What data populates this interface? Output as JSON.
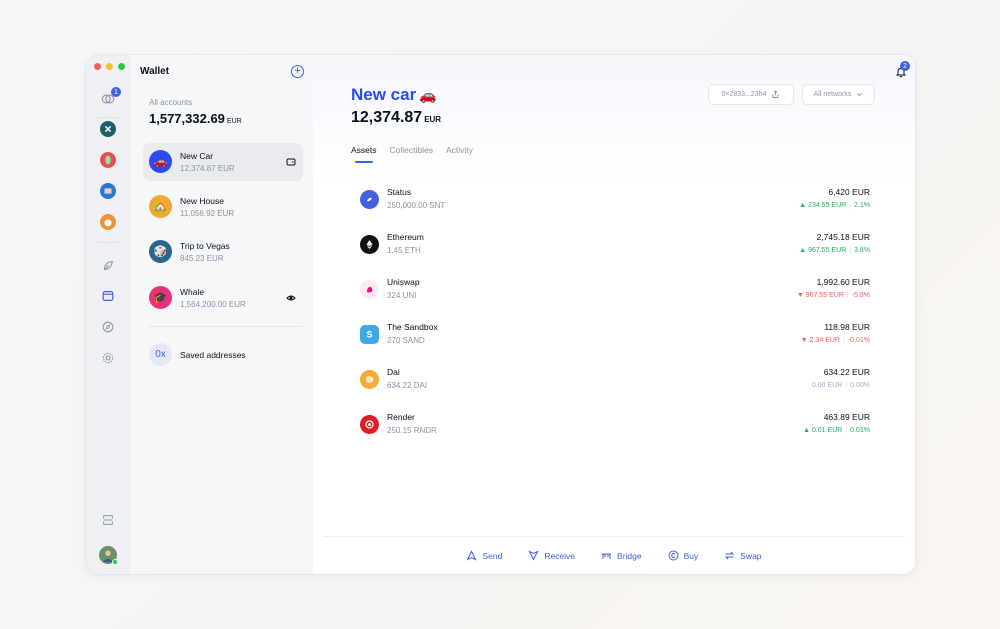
{
  "sidebar": {
    "title": "Wallet",
    "add_label": "+",
    "badge_count": "1",
    "all_accounts_label": "All accounts",
    "all_accounts_balance": "1,577,332.69",
    "currency": "EUR",
    "accounts": [
      {
        "name": "New Car",
        "balance": "12,374.87 EUR",
        "emoji": "🚗",
        "color": "#2a4af5"
      },
      {
        "name": "New House",
        "balance": "11,056.92 EUR",
        "emoji": "🏡",
        "color": "#f0a830"
      },
      {
        "name": "Trip to Vegas",
        "balance": "845.23 EUR",
        "emoji": "🎲",
        "color": "#26658c"
      },
      {
        "name": "Whale",
        "balance": "1,564,200.00 EUR",
        "emoji": "🎓",
        "color": "#e9307b"
      }
    ],
    "saved_addresses_label": "Saved addresses"
  },
  "header": {
    "notification_count": "2",
    "account_title": "New car",
    "account_emoji": "🚗",
    "account_balance": "12,374.87",
    "currency": "EUR",
    "address": "0×2833...23h4",
    "networks_label": "All networks"
  },
  "tabs": [
    "Assets",
    "Collectibles",
    "Activity"
  ],
  "assets": [
    {
      "name": "Status",
      "amount": "250,000.00 SNT",
      "value": "6,420 EUR",
      "change_value": "234.55 EUR",
      "change_pct": "2.1%",
      "trend": "up",
      "icon_color": "#4360df",
      "icon": "status-icon"
    },
    {
      "name": "Ethereum",
      "amount": "1.45 ETH",
      "value": "2,745.18 EUR",
      "change_value": "967.55 EUR",
      "change_pct": "3.8%",
      "trend": "up",
      "icon_color": "#121212",
      "icon": "ethereum-icon"
    },
    {
      "name": "Uniswap",
      "amount": "324 UNI",
      "value": "1,992.60 EUR",
      "change_value": "967.55 EUR",
      "change_pct": "-5.8%",
      "trend": "down",
      "icon_color": "#ffeaf4",
      "icon": "uniswap-icon"
    },
    {
      "name": "The Sandbox",
      "amount": "270 SAND",
      "value": "118.98 EUR",
      "change_value": "2.34 EUR",
      "change_pct": "-0.01%",
      "trend": "down",
      "icon_color": "#3fa7e6",
      "icon": "sandbox-icon"
    },
    {
      "name": "Dai",
      "amount": "634.22 DAI",
      "value": "634.22 EUR",
      "change_value": "0.00 EUR",
      "change_pct": "0.00%",
      "trend": "flat",
      "icon_color": "#f5ac37",
      "icon": "dai-icon"
    },
    {
      "name": "Render",
      "amount": "250.15 RNDR",
      "value": "463.89 EUR",
      "change_value": "0.01 EUR",
      "change_pct": "0.01%",
      "trend": "up",
      "icon_color": "#e31c25",
      "icon": "render-icon"
    }
  ],
  "actions": [
    "Send",
    "Receive",
    "Bridge",
    "Buy",
    "Swap"
  ]
}
